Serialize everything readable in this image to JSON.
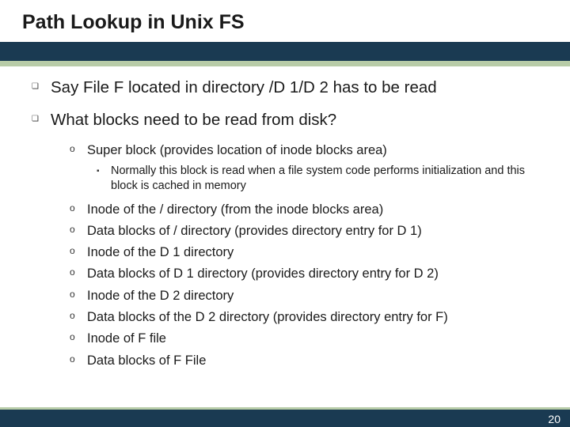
{
  "title": "Path Lookup in Unix FS",
  "bullets": [
    {
      "text": "Say File F located in directory /D 1/D 2 has to be read"
    },
    {
      "text": "What blocks need to be read from disk?"
    }
  ],
  "sub": [
    {
      "text": "Super block (provides location of inode blocks area)"
    }
  ],
  "subsub": [
    {
      "text": "Normally this block is read when a file system code performs initialization and this block is cached in memory"
    }
  ],
  "sub2": [
    {
      "text": "Inode of the / directory (from the inode blocks area)"
    },
    {
      "text": "Data blocks of / directory (provides directory entry for D 1)"
    },
    {
      "text": "Inode of the D 1 directory"
    },
    {
      "text": "Data blocks of D 1 directory (provides directory entry for D 2)"
    },
    {
      "text": "Inode of the D 2 directory"
    },
    {
      "text": "Data blocks of the D 2 directory (provides directory entry for F)"
    },
    {
      "text": "Inode of F file"
    },
    {
      "text": "Data blocks of F File"
    }
  ],
  "page": "20"
}
